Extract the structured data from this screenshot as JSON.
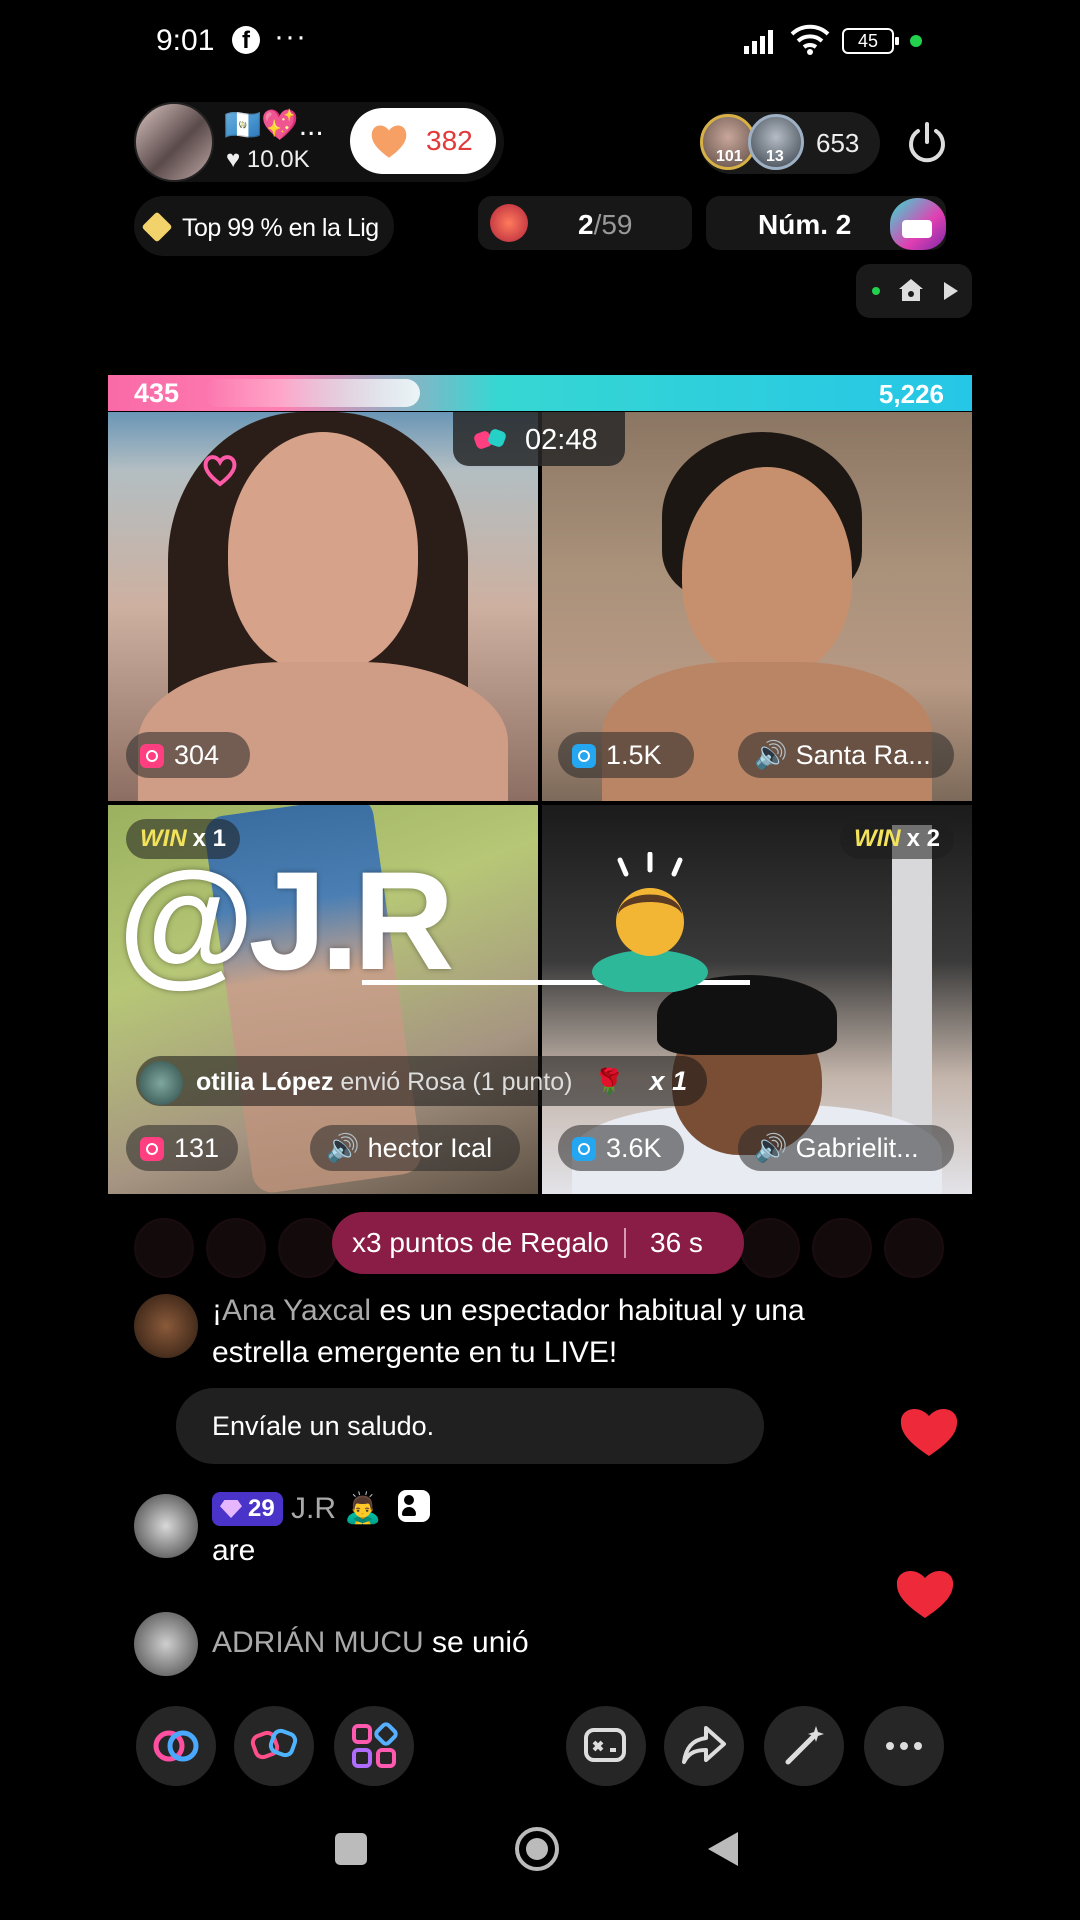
{
  "status_bar": {
    "time": "9:01",
    "app_icon": "facebook-icon",
    "more": "···",
    "battery": "45"
  },
  "host": {
    "name": "🇬🇹💖...",
    "likes": "10.0K",
    "gift_count": "382",
    "league_text": "Top 99 % en la Lig"
  },
  "viewers": {
    "badge_1": "101",
    "badge_2": "13",
    "count": "653"
  },
  "match": {
    "current": "2",
    "total": "/59"
  },
  "rank": {
    "label": "Núm. 2"
  },
  "battle": {
    "left_score": "435",
    "right_score": "5,226",
    "timer": "02:48"
  },
  "cells": [
    {
      "score": "304",
      "accent": "#ff3f7f"
    },
    {
      "score": "1.5K",
      "name": "Santa Ra...",
      "accent": "#24a6f0"
    },
    {
      "win": "WIN",
      "win_mult": "x 1",
      "score": "131",
      "name": "hector Ical",
      "accent": "#ff3f7f"
    },
    {
      "win": "WIN",
      "win_mult": "x 2",
      "score": "3.6K",
      "name": "Gabrielit...",
      "accent": "#24a6f0"
    }
  ],
  "sticker": {
    "text": "@J.R"
  },
  "gift_notice": {
    "sender": "otilia López",
    "action": "envió Rosa (1 punto)",
    "mult": "x 1"
  },
  "gift_points": {
    "label": "x3 puntos de Regalo",
    "time": "36 s"
  },
  "chat": [
    {
      "type": "system",
      "prefix": "¡",
      "user": "Ana  Yaxcal",
      "text": " es un espectador habitual y una",
      "text2": "estrella emergente en tu LIVE!",
      "action": "Envíale un saludo."
    },
    {
      "type": "comment",
      "badge": "29",
      "user": "J.R",
      "text": "are"
    },
    {
      "type": "join",
      "user": "ADRIÁN MUCU",
      "text": " se unió"
    }
  ],
  "colors": {
    "pink": "#ff3f7f",
    "blue": "#24a6f0",
    "gift_points_bg": "#8a1d45",
    "heart": "#ee2a3a"
  }
}
